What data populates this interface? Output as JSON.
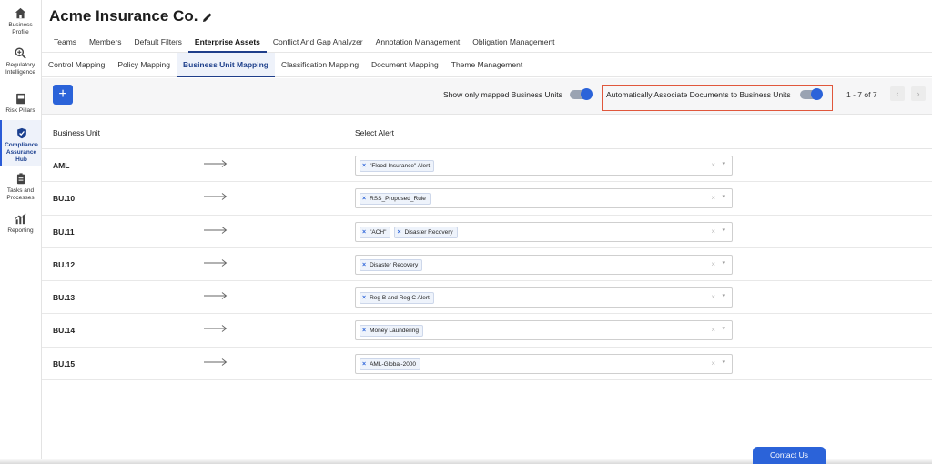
{
  "sidebar": {
    "items": [
      {
        "label": "Business Profile",
        "icon": "home-icon"
      },
      {
        "label": "Regulatory Intelligence",
        "icon": "search-plus-icon"
      },
      {
        "label": "Risk Pillars",
        "icon": "book-icon"
      },
      {
        "label": "Compliance Assurance Hub",
        "icon": "shield-check-icon"
      },
      {
        "label": "Tasks and Processes",
        "icon": "clipboard-icon"
      },
      {
        "label": "Reporting",
        "icon": "chart-icon"
      }
    ]
  },
  "header": {
    "title": "Acme Insurance Co."
  },
  "tabs": [
    "Teams",
    "Members",
    "Default Filters",
    "Enterprise Assets",
    "Conflict And Gap Analyzer",
    "Annotation Management",
    "Obligation Management"
  ],
  "subtabs": [
    "Control Mapping",
    "Policy Mapping",
    "Business Unit Mapping",
    "Classification Mapping",
    "Document Mapping",
    "Theme Management"
  ],
  "toolbar": {
    "add_label": "+",
    "toggle1_label": "Show only mapped Business Units",
    "toggle2_label": "Automatically Associate Documents to Business Units",
    "pager": "1 - 7 of 7",
    "prev": "‹",
    "next": "›"
  },
  "table": {
    "headers": [
      "Business Unit",
      "Select Alert"
    ],
    "rows": [
      {
        "unit": "AML",
        "alerts": [
          "\"Flood Insurance\" Alert"
        ]
      },
      {
        "unit": "BU.10",
        "alerts": [
          "RSS_Proposed_Rule"
        ]
      },
      {
        "unit": "BU.11",
        "alerts": [
          "\"ACH\"",
          "Disaster Recovery"
        ]
      },
      {
        "unit": "BU.12",
        "alerts": [
          "Disaster Recovery"
        ]
      },
      {
        "unit": "BU.13",
        "alerts": [
          "Reg B and Reg C Alert"
        ]
      },
      {
        "unit": "BU.14",
        "alerts": [
          "Money Laundering"
        ]
      },
      {
        "unit": "BU.15",
        "alerts": [
          "AML-Global-2000"
        ]
      }
    ]
  },
  "contact_label": "Contact Us"
}
